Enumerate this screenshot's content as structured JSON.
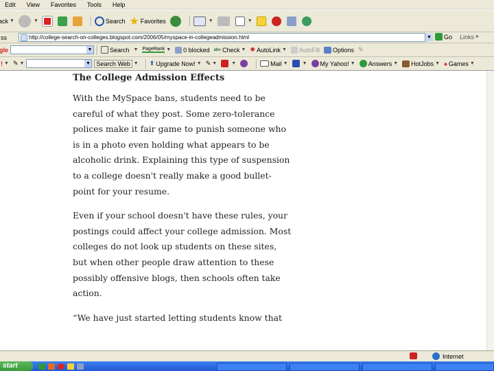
{
  "menu": [
    "Edit",
    "View",
    "Favorites",
    "Tools",
    "Help"
  ],
  "toolbar": {
    "back": "Back",
    "search": "Search",
    "favorites": "Favorites"
  },
  "address": {
    "label": "ss",
    "url": "http://college-search-on-colleges.blogspot.com/2006/05/myspace-in-collegeadmission.html",
    "go": "Go",
    "links": "Links"
  },
  "google": {
    "label": "gle",
    "search": "Search",
    "pagerank": "PageRank",
    "blocked": "0 blocked",
    "check": "Check",
    "autolink": "AutoLink",
    "autofill": "AutoFill",
    "options": "Options"
  },
  "searchbar": {
    "search_web": "Search Web",
    "upgrade": "Upgrade Now!",
    "mail": "Mail",
    "myyahoo": "My Yahoo!",
    "answers": "Answers",
    "hotjobs": "HotJobs",
    "games": "Games"
  },
  "article": {
    "heading": "The College Admission Effects",
    "paragraphs": [
      "With the MySpace bans, students need to be careful of what they post. Some zero-tolerance polices make it fair game to punish someone who is in a photo even holding what appears to be alcoholic drink. Explaining this type of suspension to a college doesn't really make a good bullet-point for your resume.",
      "Even if your school doesn't have these rules, your postings could affect your college admission. Most colleges do not look up students on these sites, but when other people draw attention to these possibly offensive blogs, then schools often take action.",
      "“We have just started letting students know that"
    ]
  },
  "status": {
    "zone": "Internet"
  },
  "taskbar": {
    "start": "start"
  },
  "colors": {
    "chrome": "#ECE9D8",
    "taskbar": "#2457d1",
    "start": "#3a9b3a"
  }
}
